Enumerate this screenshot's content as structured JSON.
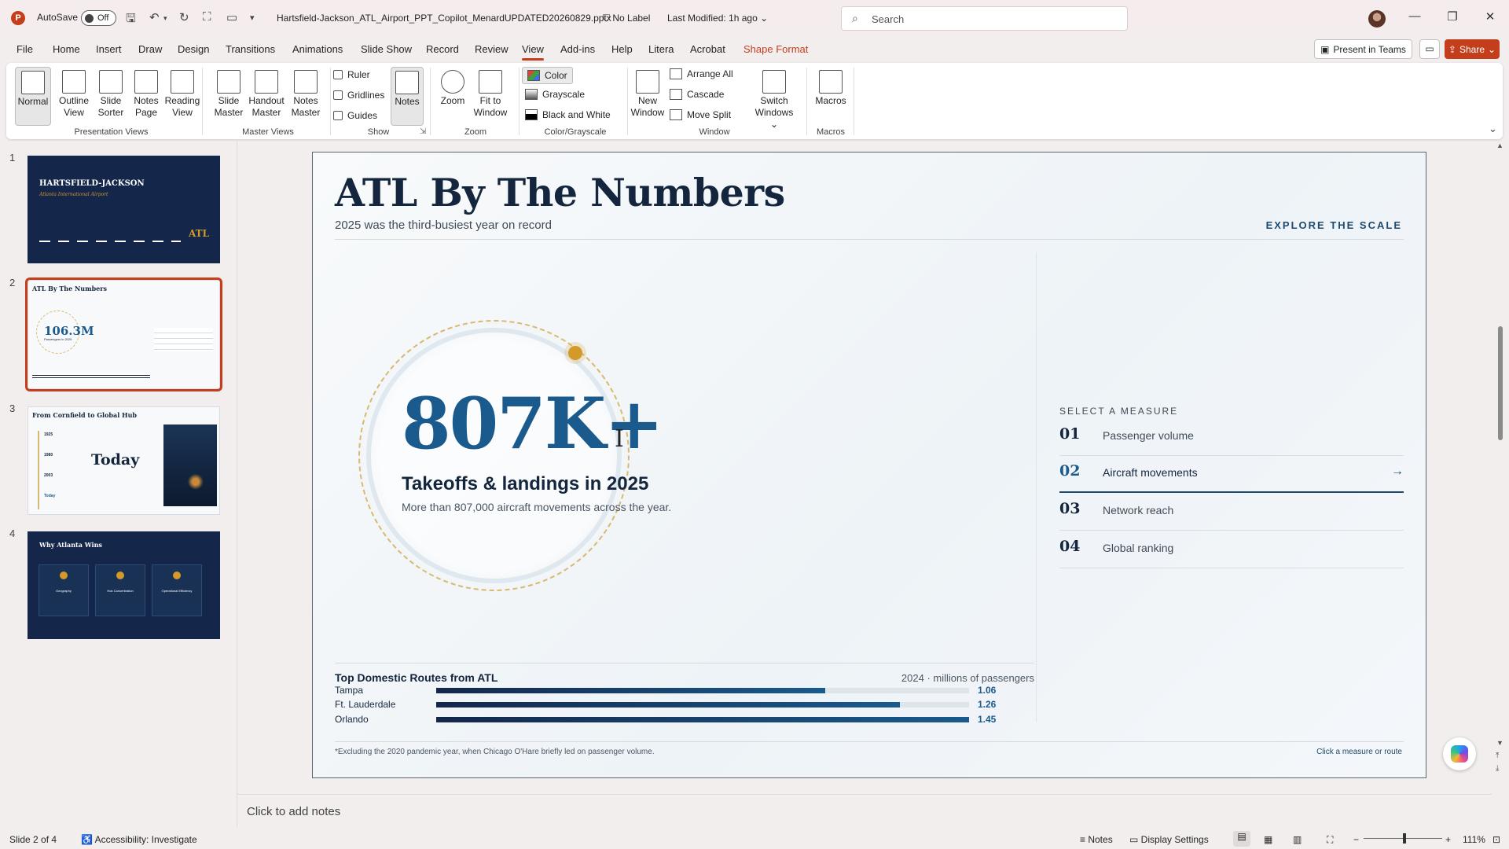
{
  "titlebar": {
    "app_logo": "P",
    "autosave_label": "AutoSave",
    "autosave_state": "Off",
    "filename": "Hartsfield-Jackson_ATL_Airport_PPT_Copilot_MenardUPDATED20260829.pptx",
    "sensitivity": "No Label",
    "modified": "Last Modified: 1h ago",
    "search_placeholder": "Search"
  },
  "menu": {
    "tabs": [
      "File",
      "Home",
      "Insert",
      "Draw",
      "Design",
      "Transitions",
      "Animations",
      "Slide Show",
      "Record",
      "Review",
      "View",
      "Add-ins",
      "Help",
      "Litera",
      "Acrobat",
      "Shape Format"
    ],
    "active": "View",
    "present_in_teams": "Present in Teams",
    "share": "Share"
  },
  "ribbon": {
    "normal": "Normal",
    "outline_view": [
      "Outline",
      "View"
    ],
    "slide_sorter": [
      "Slide",
      "Sorter"
    ],
    "notes_page": [
      "Notes",
      "Page"
    ],
    "reading_view": [
      "Reading",
      "View"
    ],
    "group_presentation_views": "Presentation Views",
    "slide_master": [
      "Slide",
      "Master"
    ],
    "handout_master": [
      "Handout",
      "Master"
    ],
    "notes_master": [
      "Notes",
      "Master"
    ],
    "group_master_views": "Master Views",
    "ruler": "Ruler",
    "gridlines": "Gridlines",
    "guides": "Guides",
    "notes": "Notes",
    "group_show": "Show",
    "zoom": "Zoom",
    "fit_to_window": [
      "Fit to",
      "Window"
    ],
    "group_zoom": "Zoom",
    "color": "Color",
    "grayscale": "Grayscale",
    "black_and_white": "Black and White",
    "group_color": "Color/Grayscale",
    "new_window": [
      "New",
      "Window"
    ],
    "arrange_all": "Arrange All",
    "cascade": "Cascade",
    "move_split": "Move Split",
    "switch_windows": [
      "Switch",
      "Windows"
    ],
    "group_window": "Window",
    "macros": "Macros",
    "group_macros": "Macros"
  },
  "thumbnails": [
    {
      "num": "1",
      "title": "HARTSFIELD-JACKSON",
      "subtitle": "Atlanta International Airport",
      "tag": "ATL"
    },
    {
      "num": "2",
      "title": "ATL By The Numbers",
      "big": "106.3M",
      "caption": "Passengers in 2025"
    },
    {
      "num": "3",
      "title": "From Cornfield to Global Hub",
      "big": "Today",
      "years": [
        "1925",
        "1980",
        "2003",
        "Today"
      ]
    },
    {
      "num": "4",
      "title": "Why Atlanta Wins",
      "cards": [
        "Geography",
        "Hub Concentration",
        "Operational Efficiency"
      ]
    }
  ],
  "slide": {
    "title": "ATL By The Numbers",
    "subtitle": "2025 was the third-busiest year on record",
    "explore": "EXPLORE THE SCALE",
    "big_number": "807K+",
    "big_label": "Takeoffs & landings in 2025",
    "big_desc": "More than 807,000 aircraft movements across the year.",
    "select_heading": "SELECT A MEASURE",
    "measures": [
      {
        "num": "01",
        "label": "Passenger volume"
      },
      {
        "num": "02",
        "label": "Aircraft movements",
        "active": true,
        "arrow": "→"
      },
      {
        "num": "03",
        "label": "Network reach"
      },
      {
        "num": "04",
        "label": "Global ranking"
      }
    ],
    "routes_title": "Top Domestic Routes from ATL",
    "routes_meta": "2024 · millions of passengers",
    "routes": [
      {
        "name": "Tampa",
        "value": "1.06",
        "share": 0.73
      },
      {
        "name": "Ft. Lauderdale",
        "value": "1.26",
        "share": 0.87
      },
      {
        "name": "Orlando",
        "value": "1.45",
        "share": 1.0
      }
    ],
    "footnote": "*Excluding the 2020 pandemic year, when Chicago O'Hare briefly led on passenger volume.",
    "foot_right": "Click a measure or route"
  },
  "notes_placeholder": "Click to add notes",
  "status": {
    "slide": "Slide 2 of 4",
    "accessibility": "Accessibility: Investigate",
    "notes": "Notes",
    "display_settings": "Display Settings",
    "zoom": "111%"
  },
  "colors": {
    "accent": "#c43e1c",
    "navy": "#14253e",
    "blue": "#1a5a8c",
    "gold": "#d39a2a"
  }
}
